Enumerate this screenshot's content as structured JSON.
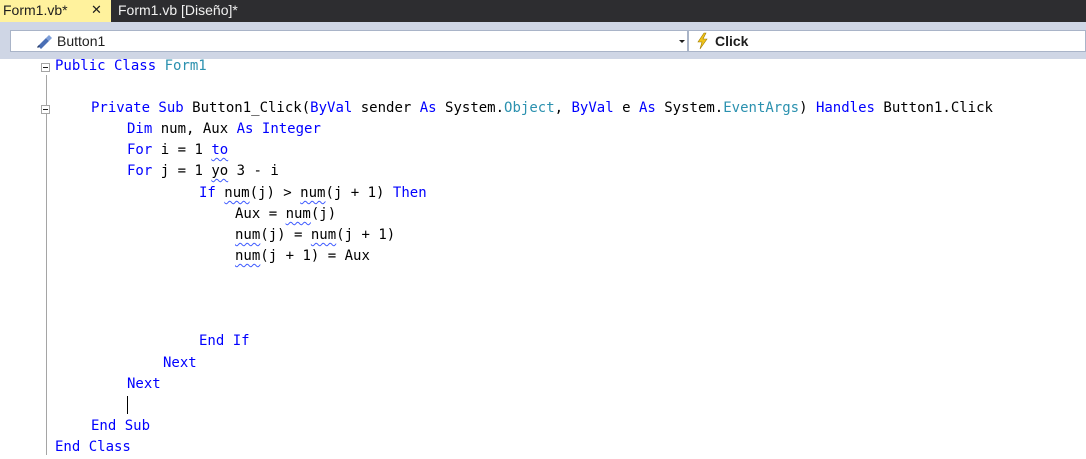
{
  "tabs": [
    {
      "label": "Form1.vb*",
      "close": "✕",
      "active": true
    },
    {
      "label": "Form1.vb [Diseño]*",
      "active": false
    }
  ],
  "navbar": {
    "object_combo": "Button1",
    "event_combo": "Click"
  },
  "colors": {
    "keyword": "#0000ff",
    "type": "#2b91af",
    "active_tab": "#fff29d",
    "tab_strip": "#2d2d30",
    "navbar": "#cfd6e5"
  },
  "code": {
    "l1": {
      "kw": "Public Class",
      "ty": "Form1"
    },
    "l3": {
      "a": "Private Sub",
      "b": " Button1_Click(",
      "c": "ByVal",
      "d": " sender ",
      "e": "As",
      "f": " System.",
      "g": "Object",
      "h": ", ",
      "i": "ByVal",
      "j": " e ",
      "k": "As",
      "l": " System.",
      "m": "EventArgs",
      "n": ") ",
      "o": "Handles",
      "p": " Button1.Click"
    },
    "l4": {
      "a": "Dim",
      "b": " num, Aux ",
      "c": "As",
      "d": " ",
      "e": "Integer"
    },
    "l5": {
      "a": "For",
      "b": " i = 1 ",
      "c": "to"
    },
    "l6": {
      "a": "For",
      "b": " j = 1 ",
      "c": "yo",
      "d": " 3 - i"
    },
    "l7": {
      "a": "If",
      "b": " ",
      "c": "num",
      "d": "(j) > ",
      "e": "num",
      "f": "(j + 1) ",
      "g": "Then"
    },
    "l8": {
      "a": "Aux = ",
      "b": "num",
      "c": "(j)"
    },
    "l9": {
      "a": "num",
      "b": "(j) = ",
      "c": "num",
      "d": "(j + 1)"
    },
    "l10": {
      "a": "num",
      "b": "(j + 1) = Aux"
    },
    "l14": {
      "a": "End If"
    },
    "l15": {
      "a": "Next"
    },
    "l16": {
      "a": "Next"
    },
    "l18": {
      "a": "End Sub"
    },
    "l19": {
      "a": "End Class"
    }
  }
}
